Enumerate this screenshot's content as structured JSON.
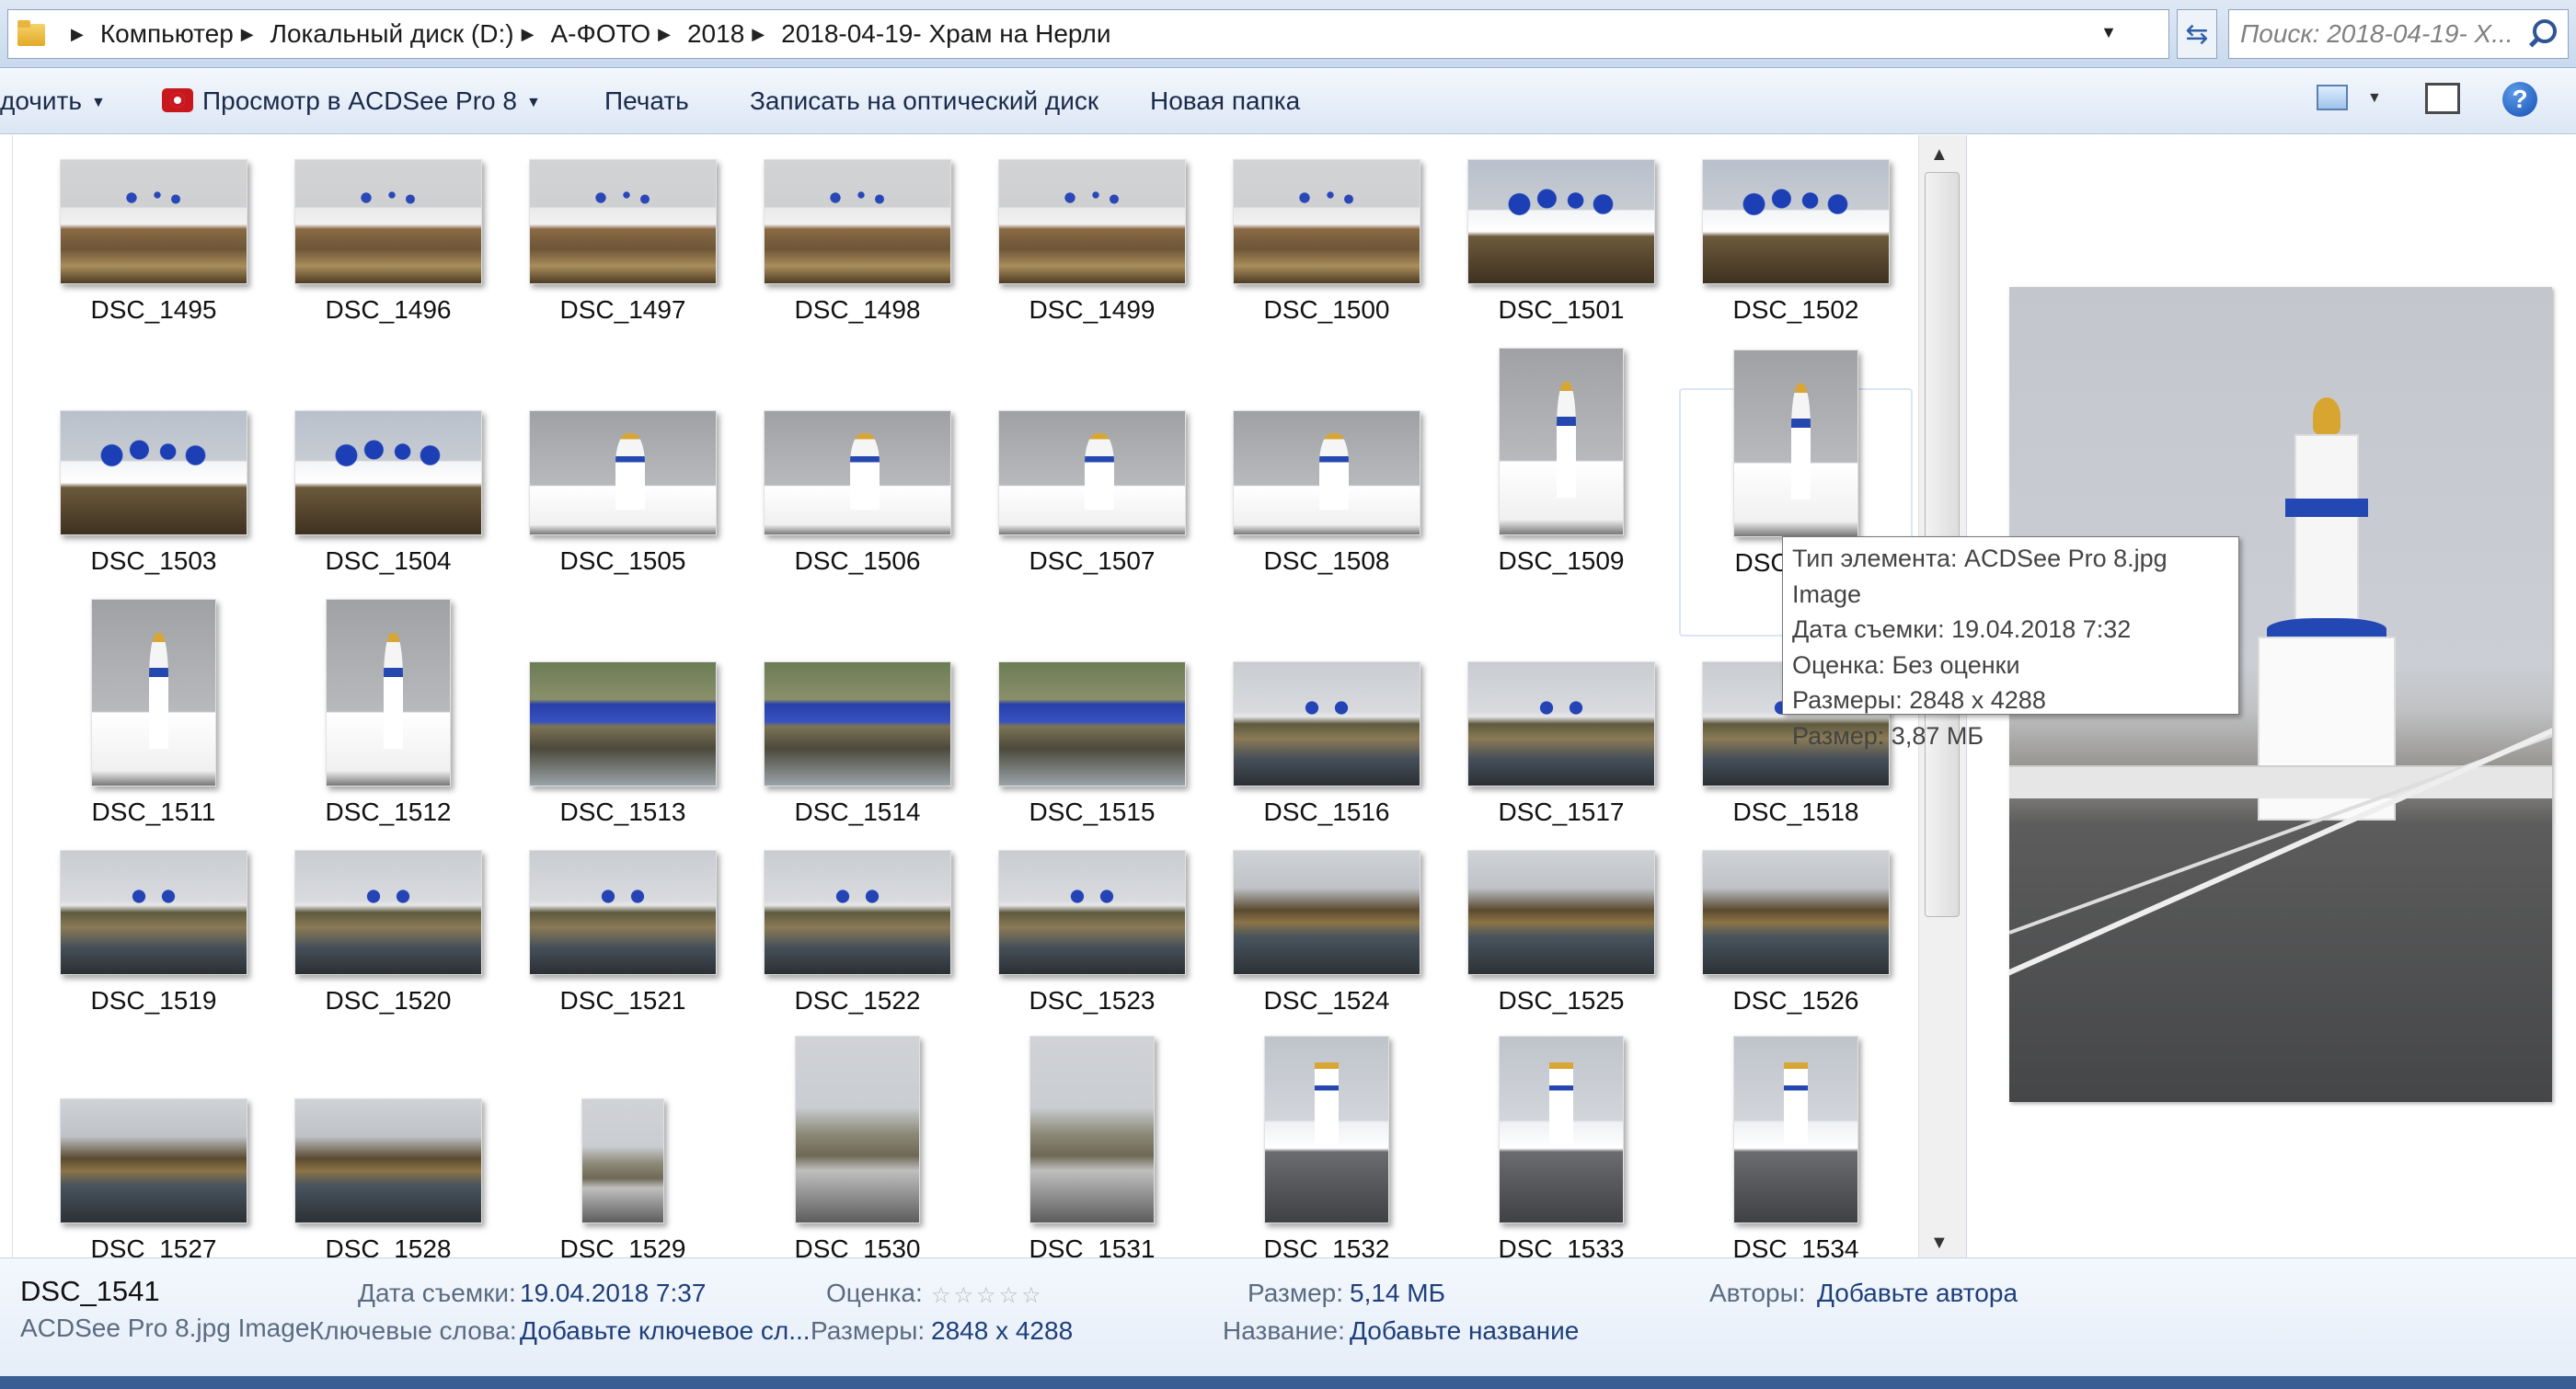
{
  "address_bar": {
    "breadcrumbs": [
      "Компьютер",
      "Локальный диск (D:)",
      "А-ФОТО",
      "2018",
      "2018-04-19- Храм на Нерли"
    ],
    "search_placeholder": "Поиск: 2018-04-19- Х..."
  },
  "toolbar": {
    "organize_label": "дочить",
    "acdsee_label": "Просмотр в ACDSee Pro 8",
    "print_label": "Печать",
    "burn_label": "Записать на оптический диск",
    "new_folder_label": "Новая папка",
    "help_label": "?"
  },
  "files": [
    {
      "name": "DSC_1495",
      "orientation": "land",
      "scene": "monastery"
    },
    {
      "name": "DSC_1496",
      "orientation": "land",
      "scene": "monastery"
    },
    {
      "name": "DSC_1497",
      "orientation": "land",
      "scene": "monastery"
    },
    {
      "name": "DSC_1498",
      "orientation": "land",
      "scene": "monastery"
    },
    {
      "name": "DSC_1499",
      "orientation": "land",
      "scene": "monastery"
    },
    {
      "name": "DSC_1500",
      "orientation": "land",
      "scene": "monastery"
    },
    {
      "name": "DSC_1501",
      "orientation": "land",
      "scene": "blue"
    },
    {
      "name": "DSC_1502",
      "orientation": "land",
      "scene": "blue"
    },
    {
      "name": "DSC_1503",
      "orientation": "land",
      "scene": "blue"
    },
    {
      "name": "DSC_1504",
      "orientation": "land",
      "scene": "blue"
    },
    {
      "name": "DSC_1505",
      "orientation": "land",
      "scene": "bell"
    },
    {
      "name": "DSC_1506",
      "orientation": "land",
      "scene": "bell"
    },
    {
      "name": "DSC_1507",
      "orientation": "land",
      "scene": "bell"
    },
    {
      "name": "DSC_1508",
      "orientation": "land",
      "scene": "bell"
    },
    {
      "name": "DSC_1509",
      "orientation": "port",
      "scene": "bell"
    },
    {
      "name": "DSC_1510",
      "orientation": "port",
      "scene": "bell",
      "selected": true
    },
    {
      "name": "DSC_1511",
      "orientation": "port",
      "scene": "bell"
    },
    {
      "name": "DSC_1512",
      "orientation": "port",
      "scene": "bell"
    },
    {
      "name": "DSC_1513",
      "orientation": "land",
      "scene": "river"
    },
    {
      "name": "DSC_1514",
      "orientation": "land",
      "scene": "river"
    },
    {
      "name": "DSC_1515",
      "orientation": "land",
      "scene": "river"
    },
    {
      "name": "DSC_1516",
      "orientation": "land",
      "scene": "lake"
    },
    {
      "name": "DSC_1517",
      "orientation": "land",
      "scene": "lake"
    },
    {
      "name": "DSC_1518",
      "orientation": "land",
      "scene": "lake"
    },
    {
      "name": "DSC_1519",
      "orientation": "land",
      "scene": "lake"
    },
    {
      "name": "DSC_1520",
      "orientation": "land",
      "scene": "lake"
    },
    {
      "name": "DSC_1521",
      "orientation": "land",
      "scene": "lake"
    },
    {
      "name": "DSC_1522",
      "orientation": "land",
      "scene": "lake"
    },
    {
      "name": "DSC_1523",
      "orientation": "land",
      "scene": "lake"
    },
    {
      "name": "DSC_1524",
      "orientation": "land",
      "scene": "trees"
    },
    {
      "name": "DSC_1525",
      "orientation": "land",
      "scene": "trees"
    },
    {
      "name": "DSC_1526",
      "orientation": "land",
      "scene": "trees"
    },
    {
      "name": "DSC_1527",
      "orientation": "land",
      "scene": "trees"
    },
    {
      "name": "DSC_1528",
      "orientation": "land",
      "scene": "trees"
    },
    {
      "name": "DSC_1529",
      "orientation": "small",
      "scene": "portroad"
    },
    {
      "name": "DSC_1530",
      "orientation": "port",
      "scene": "portroad"
    },
    {
      "name": "DSC_1531",
      "orientation": "port",
      "scene": "portroad"
    },
    {
      "name": "DSC_1532",
      "orientation": "port",
      "scene": "road"
    },
    {
      "name": "DSC_1533",
      "orientation": "port",
      "scene": "road"
    },
    {
      "name": "DSC_1534",
      "orientation": "port",
      "scene": "road"
    }
  ],
  "tooltip": {
    "lines": [
      "Тип элемента: ACDSee Pro 8.jpg Image",
      "Дата съемки: 19.04.2018 7:32",
      "Оценка: Без оценки",
      "Размеры: 2848 x 4288",
      "Размер: 3,87 МБ"
    ]
  },
  "details": {
    "file_name": "DSC_1541",
    "file_type": "ACDSee Pro 8.jpg Image",
    "date_label": "Дата съемки:",
    "date_value": "19.04.2018 7:37",
    "keywords_label": "Ключевые слова:",
    "keywords_value": "Добавьте ключевое сл...",
    "rating_label": "Оценка:",
    "rating_value": 0,
    "dimensions_label": "Размеры:",
    "dimensions_value": "2848 x 4288",
    "size_label": "Размер:",
    "size_value": "5,14 МБ",
    "title_label": "Название:",
    "title_value": "Добавьте название",
    "authors_label": "Авторы:",
    "authors_value": "Добавьте автора"
  },
  "colors": {
    "link_blue": "#1e3f7a",
    "label_gray": "#5a6b82",
    "selection": "#d8e6f6"
  }
}
